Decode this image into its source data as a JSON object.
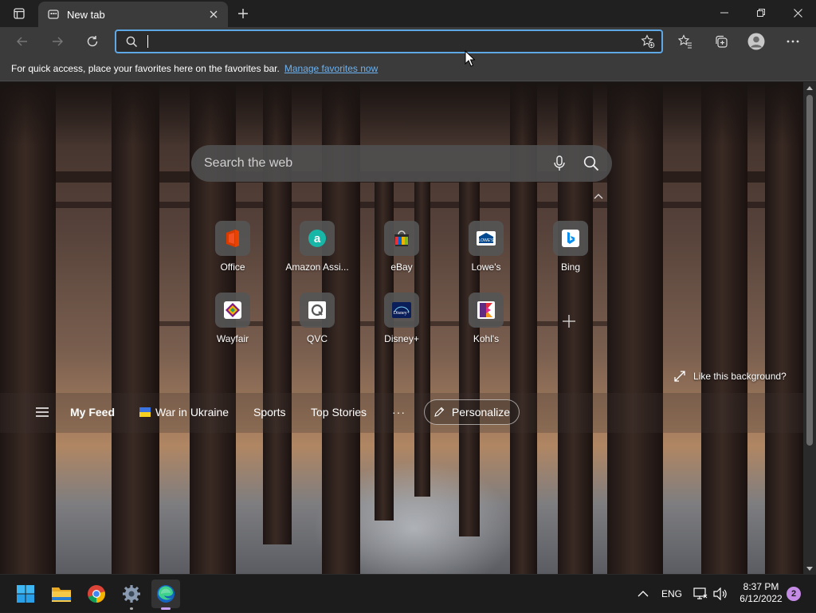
{
  "browser": {
    "tab_title": "New tab",
    "address_value": "",
    "favorites_bar_text": "For quick access, place your favorites here on the favorites bar.",
    "favorites_bar_link": "Manage favorites now"
  },
  "newtab": {
    "search_placeholder": "Search the web",
    "tiles": [
      {
        "label": "Office",
        "icon": "office-icon"
      },
      {
        "label": "Amazon Assi...",
        "icon": "amazon-assistant-icon"
      },
      {
        "label": "eBay",
        "icon": "ebay-icon"
      },
      {
        "label": "Lowe's",
        "icon": "lowes-icon"
      },
      {
        "label": "Bing",
        "icon": "bing-icon"
      },
      {
        "label": "Wayfair",
        "icon": "wayfair-icon"
      },
      {
        "label": "QVC",
        "icon": "qvc-icon"
      },
      {
        "label": "Disney+",
        "icon": "disney-plus-icon"
      },
      {
        "label": "Kohl's",
        "icon": "kohls-icon"
      }
    ],
    "like_background": "Like this background?",
    "feed": {
      "items": [
        "My Feed",
        "War in Ukraine",
        "Sports",
        "Top Stories"
      ],
      "more": "···",
      "personalize": "Personalize"
    }
  },
  "taskbar": {
    "language": "ENG",
    "time": "8:37 PM",
    "date": "6/12/2022",
    "notification_count": "2"
  },
  "colors": {
    "accent": "#5fa8e6",
    "link": "#6cb2f0",
    "notification": "#c58ce6"
  }
}
